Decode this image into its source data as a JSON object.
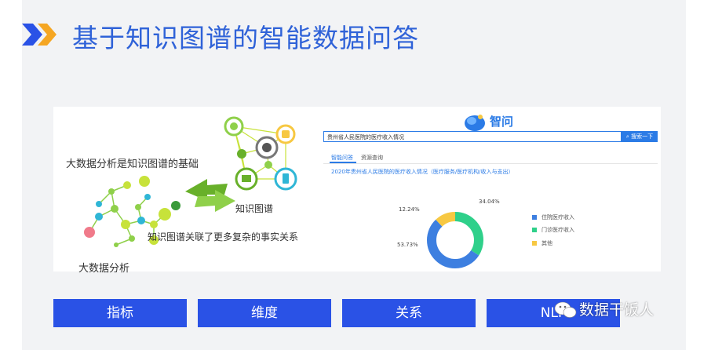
{
  "slide": {
    "title": "基于知识图谱的智能数据问答",
    "accent_color": "#2f62d8",
    "arrow_colors": [
      "#2a52e6",
      "#f5a623"
    ]
  },
  "left_panel": {
    "text_foundation": "大数据分析是知识图谱的基础",
    "text_kg": "知识图谱",
    "text_relation": "知识图谱关联了更多复杂的事实关系",
    "text_bigdata": "大数据分析"
  },
  "app": {
    "logo_text": "智问",
    "search_value": "贵州省人民医院的医疗收入情况",
    "search_button": "搜索一下",
    "tabs": [
      "智能问答",
      "资源查询"
    ],
    "active_tab": 0,
    "result_title": "2020年贵州省人民医院的医疗收入情况（医疗服务/医疗机构/收入与支出）",
    "chart_data": {
      "type": "pie",
      "categories": [
        "住院医疗收入",
        "门诊医疗收入",
        "其他"
      ],
      "values": [
        53.73,
        34.04,
        12.24
      ],
      "labels": [
        "53.73%",
        "34.04%",
        "12.24%"
      ],
      "colors": [
        "#3d7fe0",
        "#2fd08a",
        "#f7c842"
      ]
    }
  },
  "buttons": {
    "indicator": "指标",
    "dimension": "维度",
    "relation": "关系",
    "nlp": "NLP"
  },
  "watermark": "数据干饭人"
}
